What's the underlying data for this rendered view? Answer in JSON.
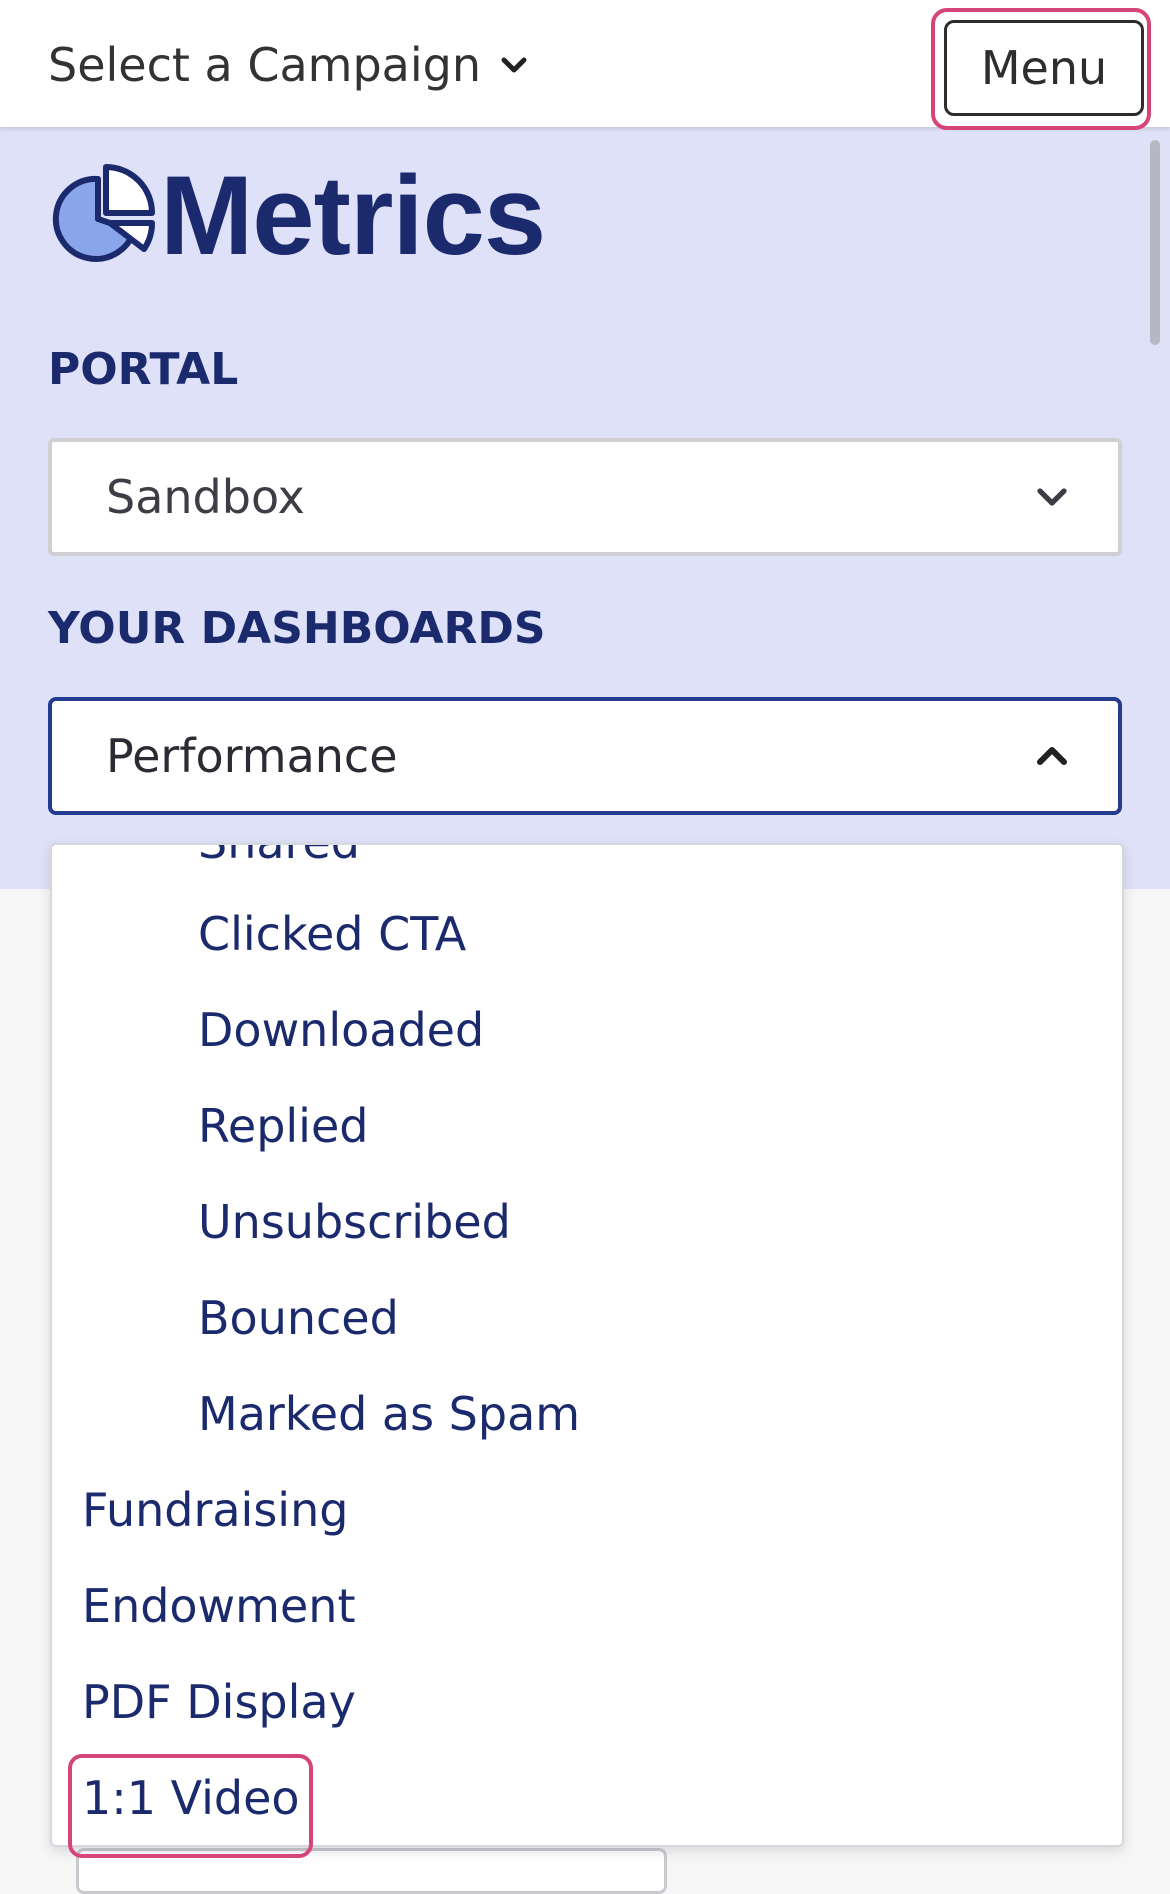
{
  "header": {
    "campaign_select_label": "Select a Campaign",
    "menu_label": "Menu"
  },
  "brand": {
    "name": "Metrics"
  },
  "portal": {
    "label": "PORTAL",
    "selected": "Sandbox"
  },
  "dashboards": {
    "label": "YOUR DASHBOARDS",
    "selected": "Performance",
    "options": [
      {
        "label": "Shared",
        "level": "sub"
      },
      {
        "label": "Clicked CTA",
        "level": "sub"
      },
      {
        "label": "Downloaded",
        "level": "sub"
      },
      {
        "label": "Replied",
        "level": "sub"
      },
      {
        "label": "Unsubscribed",
        "level": "sub"
      },
      {
        "label": "Bounced",
        "level": "sub"
      },
      {
        "label": "Marked as Spam",
        "level": "sub"
      },
      {
        "label": "Fundraising",
        "level": "top"
      },
      {
        "label": "Endowment",
        "level": "top"
      },
      {
        "label": "PDF Display",
        "level": "top"
      },
      {
        "label": "1:1 Video",
        "level": "top"
      }
    ]
  },
  "colors": {
    "brand_navy": "#1b2a6d",
    "hero_background": "#dfe1f8",
    "highlight": "#d6457a",
    "focus_border": "#243b8f",
    "logo_fill": "#8aa6ea"
  },
  "icons": {
    "campaign_chevron": "chevron-down-icon",
    "portal_chevron": "chevron-down-icon",
    "dashboard_chevron": "chevron-up-icon",
    "logo": "pie-chart-icon"
  }
}
